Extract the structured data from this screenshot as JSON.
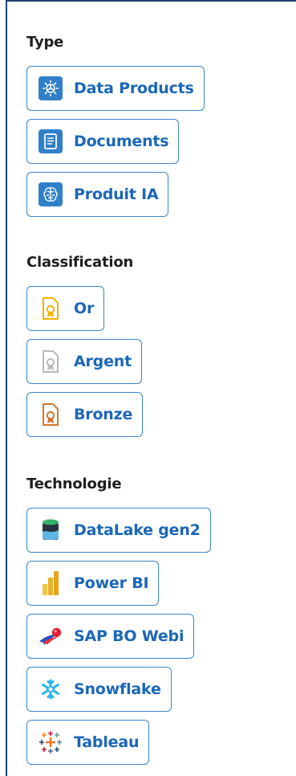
{
  "sections": {
    "type": {
      "title": "Type",
      "items": [
        {
          "label": "Data Products",
          "icon": "data-products-icon"
        },
        {
          "label": "Documents",
          "icon": "document-icon"
        },
        {
          "label": "Produit IA",
          "icon": "ai-brain-icon"
        }
      ]
    },
    "classification": {
      "title": "Classification",
      "items": [
        {
          "label": "Or",
          "icon": "gold-certificate-icon",
          "color": "#f2b200"
        },
        {
          "label": "Argent",
          "icon": "silver-certificate-icon",
          "color": "#b9b9b9"
        },
        {
          "label": "Bronze",
          "icon": "bronze-certificate-icon",
          "color": "#d1782e"
        }
      ]
    },
    "technologie": {
      "title": "Technologie",
      "items": [
        {
          "label": "DataLake gen2",
          "icon": "datalake-icon"
        },
        {
          "label": "Power BI",
          "icon": "power-bi-icon"
        },
        {
          "label": "SAP BO Webi",
          "icon": "sap-bo-webi-icon"
        },
        {
          "label": "Snowflake",
          "icon": "snowflake-icon"
        },
        {
          "label": "Tableau",
          "icon": "tableau-icon"
        }
      ]
    }
  },
  "colors": {
    "accent": "#1b67b7",
    "chip_border": "#3b86c6",
    "panel_border": "#1f3f6e"
  }
}
